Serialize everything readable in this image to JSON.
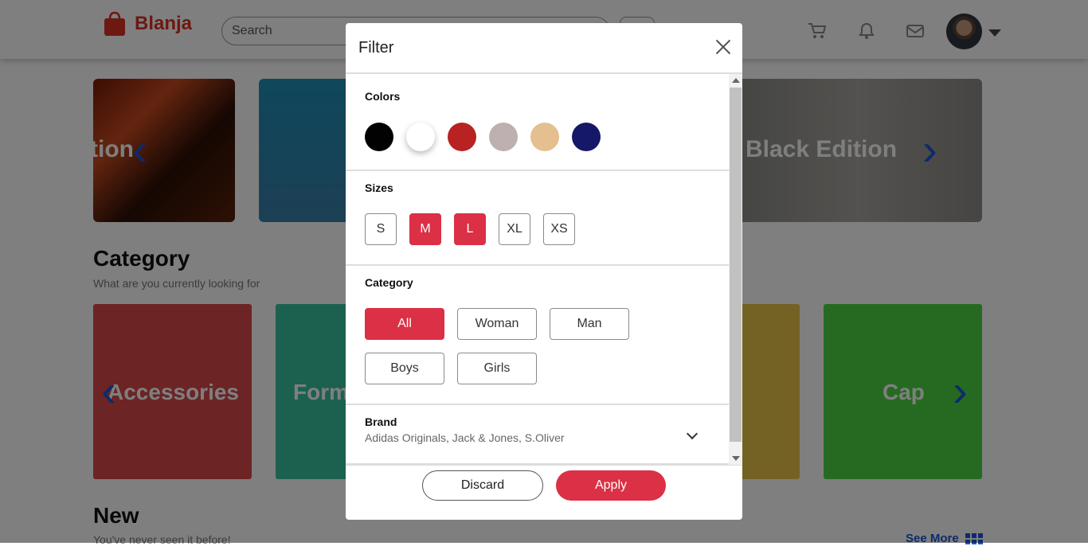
{
  "navbar": {
    "brand": "Blanja",
    "search_placeholder": "Search"
  },
  "promo": {
    "left_text": "tion",
    "right_text": "Black Edition"
  },
  "category_section": {
    "title": "Category",
    "subtitle": "What are you currently looking for",
    "cards": [
      "Accessories",
      "Form",
      "Cap"
    ]
  },
  "new_section": {
    "title": "New",
    "subtitle": "You've never seen it before!",
    "see_more": "See More"
  },
  "modal": {
    "title": "Filter",
    "colors": {
      "label": "Colors",
      "swatches": [
        "#020202",
        "#ffffff",
        "#b82222",
        "#beb0b0",
        "#e5bf8f",
        "#151867"
      ]
    },
    "sizes": {
      "label": "Sizes",
      "options": [
        "S",
        "M",
        "L",
        "XL",
        "XS"
      ],
      "selected": [
        "M",
        "L"
      ]
    },
    "category": {
      "label": "Category",
      "options": [
        "All",
        "Woman",
        "Man",
        "Boys",
        "Girls"
      ],
      "selected": "All"
    },
    "brand": {
      "label": "Brand",
      "value": "Adidas Originals, Jack & Jones, S.Oliver"
    },
    "discard_label": "Discard",
    "apply_label": "Apply"
  },
  "colors": {
    "accent": "#db3045",
    "brand": "#db3022",
    "link": "#1a56d6"
  }
}
